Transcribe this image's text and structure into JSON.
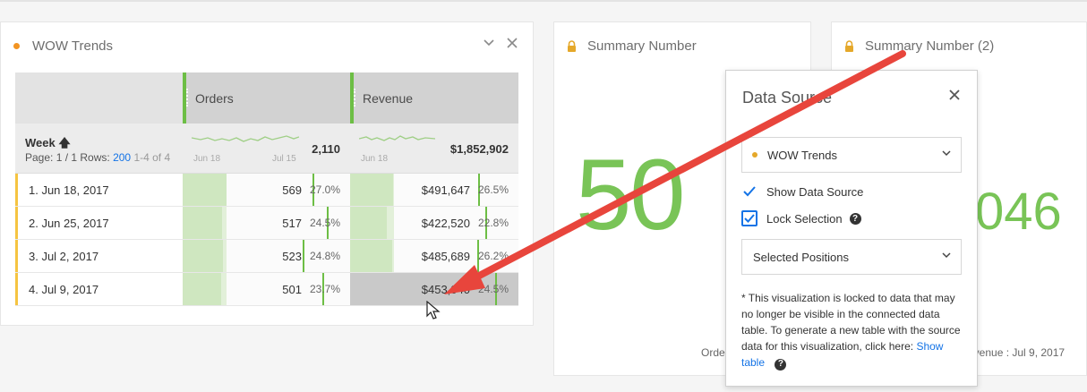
{
  "panels": {
    "wow": {
      "title": "WOW Trends",
      "columns": [
        "Orders",
        "Revenue"
      ],
      "dimension": {
        "label": "Week",
        "page_text": "Page: 1 / 1 Rows:",
        "rows_value": "200",
        "range": "1-4 of 4"
      },
      "totals": {
        "orders": "2,110",
        "revenue": "$1,852,902",
        "orders_spark_start": "Jun 18",
        "orders_spark_end": "Jul 15",
        "revenue_spark_start": "Jun 18"
      },
      "rows": [
        {
          "week": "1.  Jun 18, 2017",
          "orders": "569",
          "orders_pct": "27.0%",
          "orders_share": 0.27,
          "revenue": "$491,647",
          "revenue_pct": "26.5%",
          "revenue_share": 0.265
        },
        {
          "week": "2.  Jun 25, 2017",
          "orders": "517",
          "orders_pct": "24.5%",
          "orders_share": 0.245,
          "revenue": "$422,520",
          "revenue_pct": "22.8%",
          "revenue_share": 0.228
        },
        {
          "week": "3.  Jul 2, 2017",
          "orders": "523",
          "orders_pct": "24.8%",
          "orders_share": 0.248,
          "revenue": "$485,689",
          "revenue_pct": "26.2%",
          "revenue_share": 0.262
        },
        {
          "week": "4.  Jul 9, 2017",
          "orders": "501",
          "orders_pct": "23.7%",
          "orders_share": 0.237,
          "revenue": "$453,040",
          "revenue_pct": "24.5%",
          "revenue_share": 0.245
        }
      ]
    },
    "summary1": {
      "title": "Summary Number",
      "big_value": "50",
      "footer": "Orde"
    },
    "summary2": {
      "title": "Summary Number (2)",
      "big_value": "046",
      "footer": "evenue : Jul 9, 2017"
    }
  },
  "popover": {
    "title": "Data Source",
    "source_value": "WOW Trends",
    "show_data_source": "Show Data Source",
    "lock_selection": "Lock Selection",
    "positions_value": "Selected Positions",
    "note": "* This visualization is locked to data that may no longer be visible in the connected data table. To generate a new table with the source data for this visualization, click here:",
    "note_link": "Show table"
  },
  "colors": {
    "accent_green": "#6dbe45",
    "big_number": "#79c457",
    "orange_dot": "#f29423",
    "link_blue": "#1473e6",
    "arrow_red": "#e8453c"
  }
}
